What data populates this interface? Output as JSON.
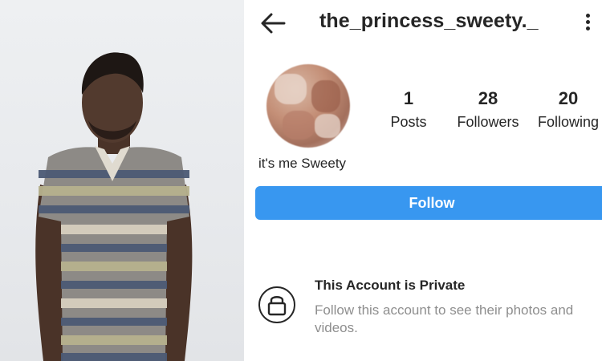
{
  "photo": {
    "description_icon": "person-photo",
    "colors": {
      "background": "#e9ebee",
      "shirt_stripes": [
        "#4c5a75",
        "#b7b28e",
        "#8d8a86",
        "#d7cfbe"
      ]
    }
  },
  "profile": {
    "username": "the_princess_sweety._",
    "back_icon": "arrow-left-icon",
    "menu_icon": "more-vertical-icon",
    "stats": [
      {
        "value": "1",
        "label": "Posts"
      },
      {
        "value": "28",
        "label": "Followers"
      },
      {
        "value": "20",
        "label": "Following"
      }
    ],
    "bio": "it's me Sweety",
    "follow_label": "Follow",
    "private": {
      "icon": "lock-icon",
      "title": "This Account is Private",
      "subtitle": "Follow this account to see their photos and videos."
    }
  },
  "colors": {
    "accent": "#3897f0",
    "text": "#262626",
    "muted": "#8e8e8e"
  }
}
